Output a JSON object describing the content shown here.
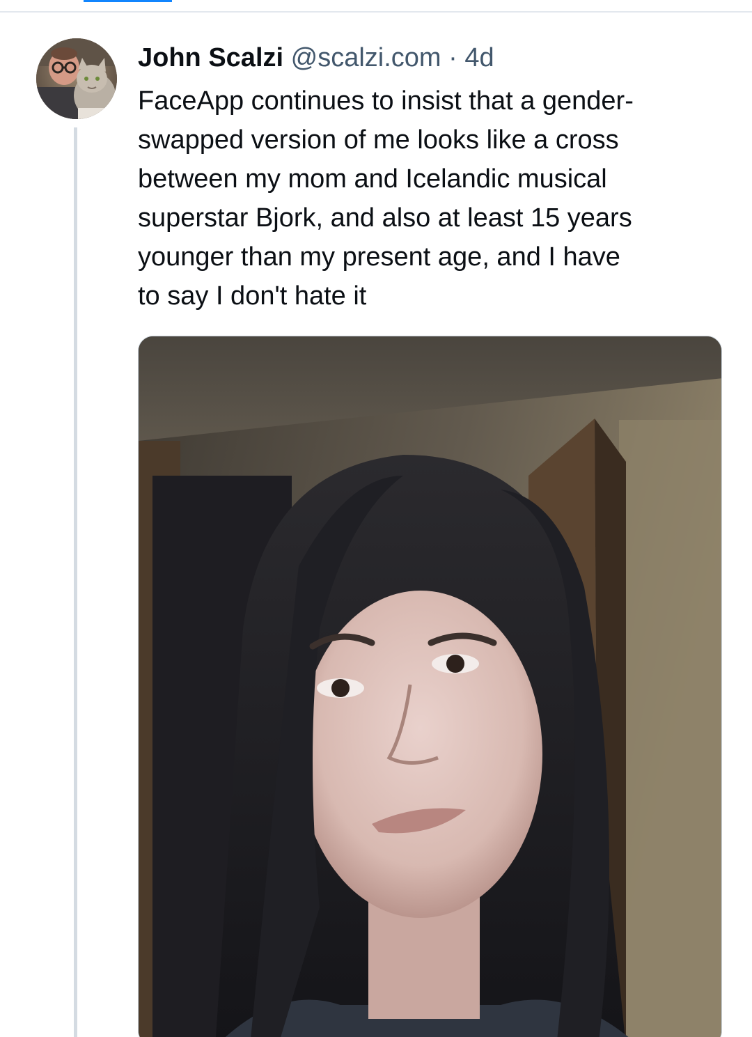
{
  "post": {
    "author": {
      "display_name": "John Scalzi",
      "handle": "@scalzi.com",
      "separator": "·",
      "timestamp": "4d"
    },
    "text_lines": [
      "FaceApp continues to insist that a gender-",
      "swapped version of me looks like a cross",
      "between my mom and Icelandic musical",
      "superstar Bjork, and also at least 15 years",
      "younger than my present age, and I have",
      "to say I don't hate it"
    ],
    "media": {
      "type": "photo",
      "icon": "portrait-photo"
    }
  },
  "colors": {
    "accent": "#1185fe",
    "text_primary": "#0b0f14",
    "text_secondary": "#42576c",
    "thread_line": "#d4dbe2"
  }
}
